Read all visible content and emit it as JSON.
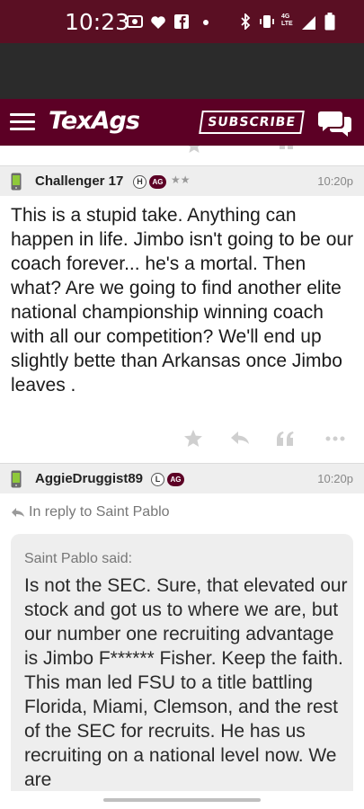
{
  "status_bar": {
    "time": "10:23",
    "network": "4G LTE"
  },
  "nav": {
    "logo": "TexAgs",
    "subscribe_label": "SUBSCRIBE"
  },
  "posts": [
    {
      "username": "Challenger 17",
      "badges": [
        "H",
        "AG"
      ],
      "stars": "★★",
      "time": "10:20p",
      "body": "This is a stupid take. Anything can happen in life. Jimbo isn't going to be our coach forever... he's a mortal. Then what? Are we going to find another elite national championship winning coach with all our competition? We'll end up slightly bette than Arkansas once Jimbo leaves ."
    },
    {
      "username": "AggieDruggist89",
      "badges": [
        "L",
        "AG"
      ],
      "time": "10:20p",
      "reply_to": "In reply to Saint Pablo",
      "quote_author": "Saint Pablo said:",
      "quote_text": "Is not the SEC. Sure, that elevated our stock and got us to where we are, but our number one recruiting advantage is Jimbo F****** Fisher. Keep the faith. This man led FSU to a title battling Florida, Miami, Clemson, and the rest of the SEC for recruits. He has us recruiting on a national level now. We are"
    }
  ],
  "colors": {
    "maroon": "#5c0025",
    "header_gray": "#eeeeee"
  }
}
